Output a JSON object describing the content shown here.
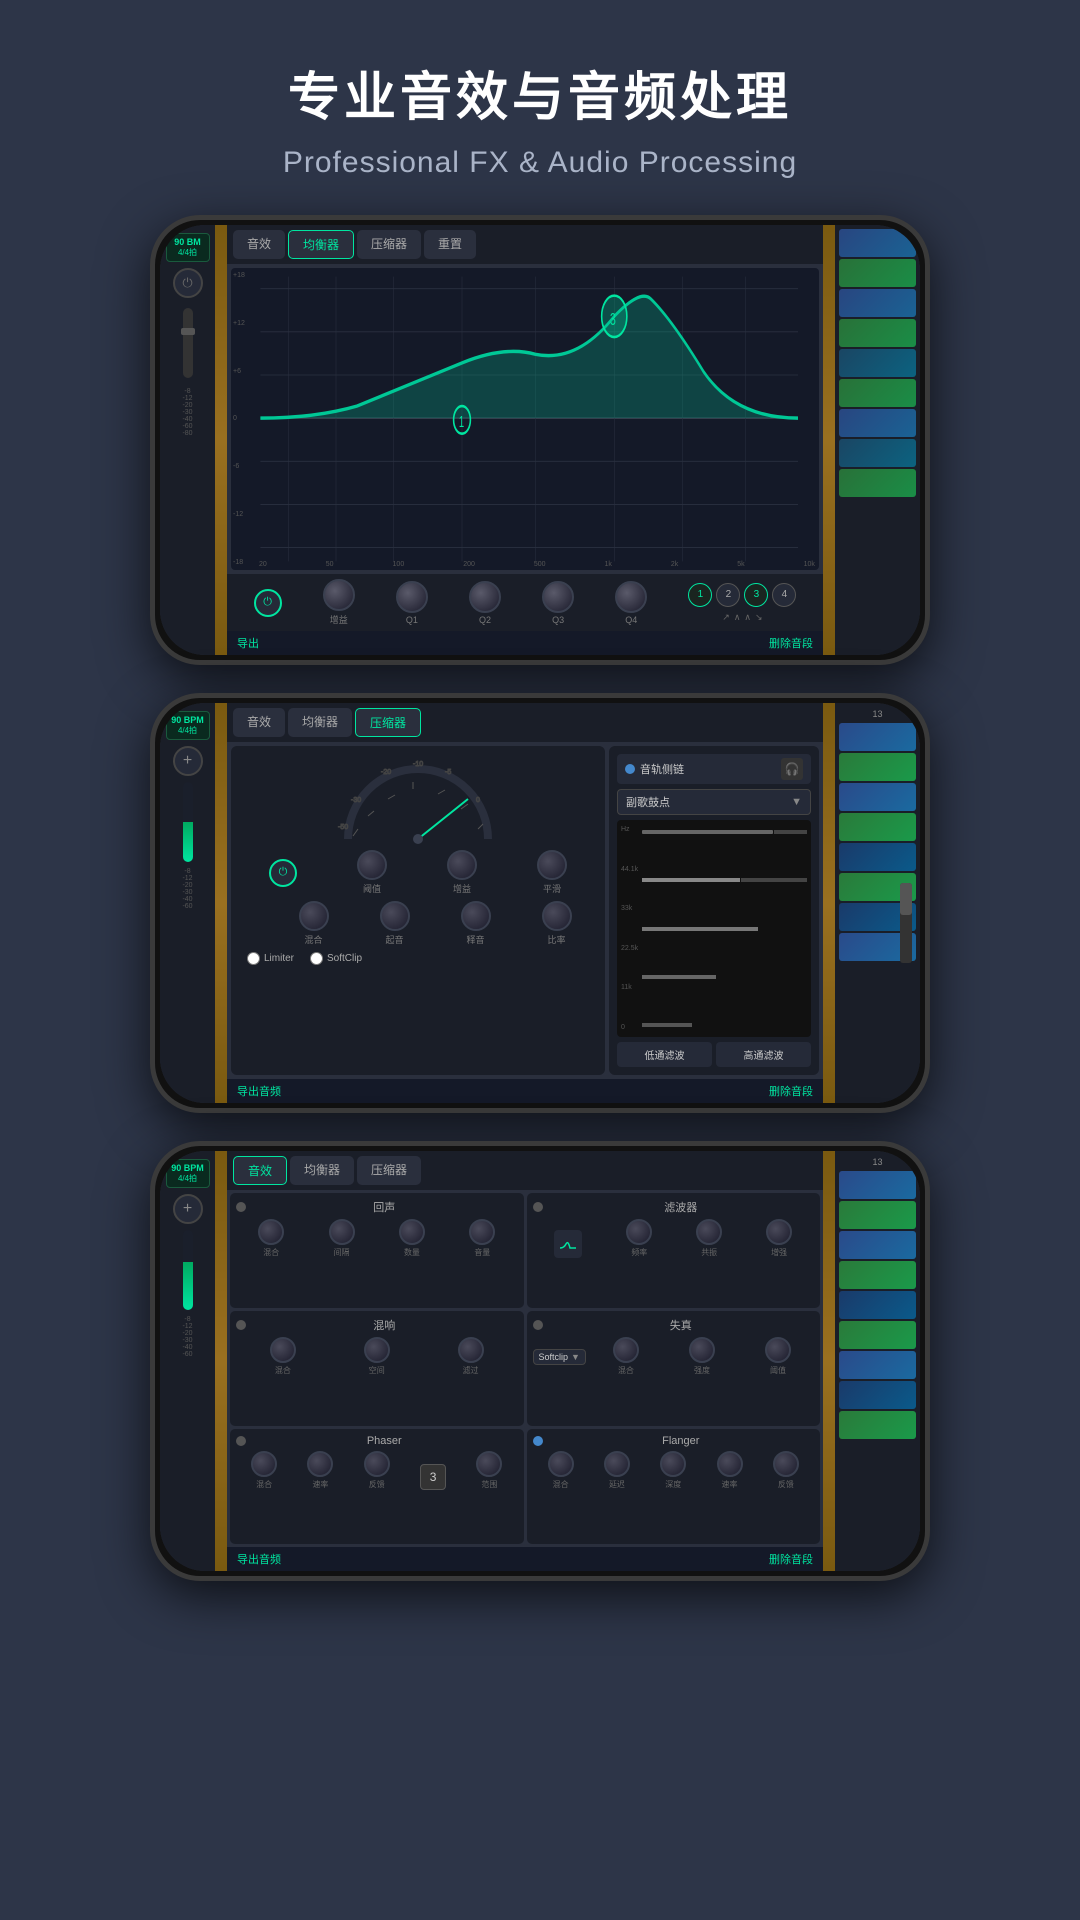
{
  "header": {
    "title_cn": "专业音效与音频处理",
    "title_en": "Professional FX & Audio Processing"
  },
  "screen1": {
    "bpm": "90 BM",
    "sig": "4/4拍",
    "tabs": [
      "音效",
      "均衡器",
      "压缩器",
      "重置"
    ],
    "active_tab": 1,
    "eq_y_labels": [
      "+18",
      "+12",
      "+6",
      "0",
      "-6",
      "-12",
      "-18"
    ],
    "eq_x_labels": [
      "20",
      "50",
      "100",
      "200",
      "500",
      "1k",
      "2k",
      "5k",
      "10k"
    ],
    "knobs": [
      "增益",
      "Q1",
      "Q2",
      "Q3",
      "Q4"
    ],
    "band_buttons": [
      "1",
      "2",
      "3",
      "4"
    ],
    "band_shapes": [
      "↗",
      "∧",
      "∧",
      "↘"
    ],
    "bottom_left": "导出",
    "bottom_right": "删除音段"
  },
  "screen2": {
    "bpm": "90 BPM",
    "sig": "4/4拍",
    "tabs": [
      "音效",
      "均衡器",
      "压缩器"
    ],
    "active_tab": 2,
    "comp_knobs": [
      "阈值",
      "增益",
      "平滑",
      "混合",
      "起音",
      "释音",
      "比率"
    ],
    "sidechain_label": "音轨侧链",
    "sidechain_select": "副歌鼓点",
    "freq_labels": [
      "Hz",
      "44.1k",
      "33k",
      "22.5k",
      "11k",
      "0"
    ],
    "filter_low": "低通滤波",
    "filter_high": "高通滤波",
    "limiter_label": "Limiter",
    "softclip_label": "SoftClip",
    "bottom_left": "导出音频",
    "bottom_right": "删除音段"
  },
  "screen3": {
    "bpm": "90 BPM",
    "sig": "4/4拍",
    "tabs": [
      "音效",
      "均衡器",
      "压缩器"
    ],
    "active_tab": 0,
    "fx_blocks": [
      {
        "name": "回声",
        "knobs": [
          "混合",
          "间隔",
          "数量",
          "音量"
        ],
        "active": false
      },
      {
        "name": "滤波器",
        "knobs": [
          "频率",
          "共振",
          "增强"
        ],
        "active": false,
        "has_shape": true
      },
      {
        "name": "混响",
        "knobs": [
          "混合",
          "空间",
          "滤过"
        ],
        "active": false,
        "has_dropdown": false
      },
      {
        "name": "失真",
        "knobs": [
          "混合",
          "强度",
          "阈值"
        ],
        "active": false,
        "has_dropdown": true,
        "dropdown_value": "Softclip"
      },
      {
        "name": "Phaser",
        "knobs": [
          "混合",
          "速率",
          "反馈",
          "范围"
        ],
        "active": false,
        "has_number": true,
        "number_value": "3"
      },
      {
        "name": "Flanger",
        "knobs": [
          "混合",
          "延迟",
          "深度",
          "速率",
          "反馈"
        ],
        "active": true
      }
    ],
    "bottom_left": "导出音频",
    "bottom_right": "删除音段"
  }
}
